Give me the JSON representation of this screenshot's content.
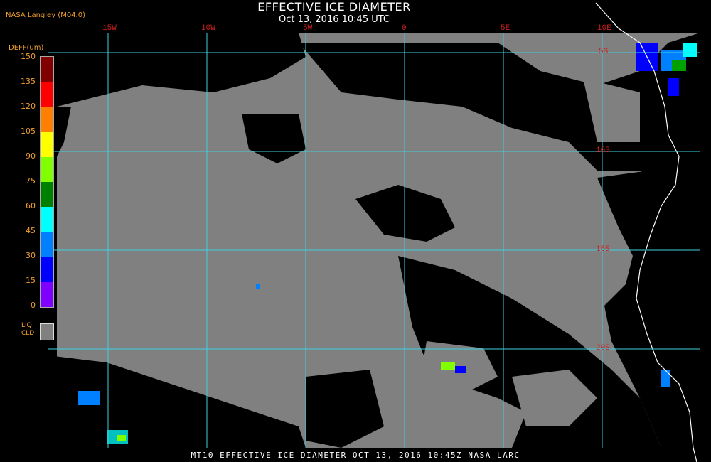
{
  "header": {
    "title": "EFFECTIVE ICE DIAMETER",
    "subtitle": "Oct 13, 2016 10:45 UTC",
    "brand": "NASA Langley (M04.0)"
  },
  "legend": {
    "title": "DEFF(um)",
    "ticks": [
      "150",
      "135",
      "120",
      "105",
      "90",
      "75",
      "60",
      "45",
      "30",
      "15",
      "0"
    ],
    "colors": [
      "#800000",
      "#ff0000",
      "#ff8000",
      "#ffff00",
      "#80ff00",
      "#008000",
      "#00ffff",
      "#0080ff",
      "#0000ff",
      "#8000ff"
    ],
    "liq_label_1": "LIQ",
    "liq_label_2": "CLD",
    "liq_color": "#808080"
  },
  "grid": {
    "lon_labels": [
      "15W",
      "10W",
      "5W",
      "0",
      "5E",
      "10E"
    ],
    "lat_labels": [
      "5S",
      "10S",
      "15S",
      "20S"
    ],
    "line_color": "#40d0e0"
  },
  "footer": {
    "text": "MT10  EFFECTIVE ICE DIAMETER   OCT 13, 2016 10:45Z   NASA LARC"
  }
}
